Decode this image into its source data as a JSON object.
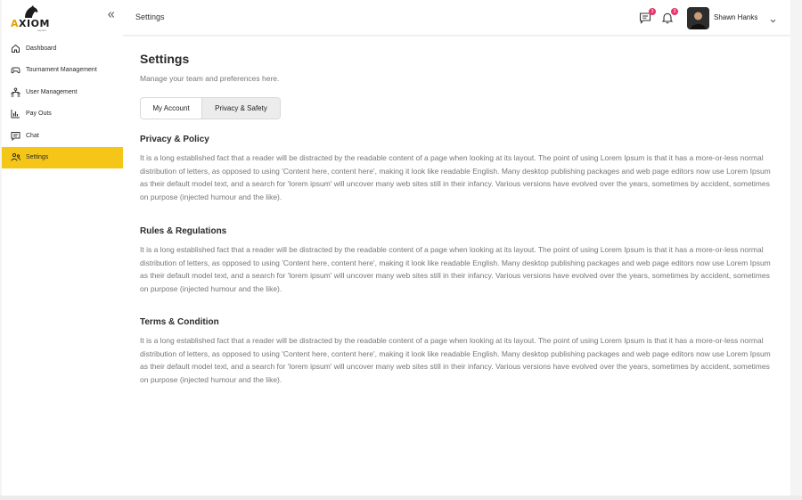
{
  "brand": {
    "name_prefix": "A",
    "name_rest": "XIOM",
    "tagline": "esports"
  },
  "sidebar": {
    "items": [
      {
        "label": "Dashboard",
        "icon": "home-icon",
        "active": false
      },
      {
        "label": "Tournament Management",
        "icon": "gamepad-icon",
        "active": false
      },
      {
        "label": "User Management",
        "icon": "users-org-icon",
        "active": false
      },
      {
        "label": "Pay Outs",
        "icon": "bar-chart-icon",
        "active": false
      },
      {
        "label": "Chat",
        "icon": "chat-icon",
        "active": false
      },
      {
        "label": "Settings",
        "icon": "people-gear-icon",
        "active": true
      }
    ]
  },
  "header": {
    "title": "Settings",
    "messages_badge": "3",
    "notifications_badge": "3",
    "user_name": "Shawn Hanks"
  },
  "main": {
    "title": "Settings",
    "subtitle": "Manage your team and preferences here.",
    "tabs": [
      {
        "label": "My Account",
        "active": false
      },
      {
        "label": "Privacy & Safety",
        "active": true
      }
    ],
    "sections": [
      {
        "title": "Privacy & Policy",
        "body": "It is a long established fact that a reader will be distracted by the readable content of a page when looking at its layout. The point of using Lorem Ipsum is that it has a more-or-less normal distribution of letters, as opposed to using 'Content here, content here', making it look like readable English. Many desktop publishing packages and web page editors now use Lorem Ipsum as their default model text, and a search for 'lorem ipsum' will uncover many web sites still in their infancy. Various versions have evolved over the years, sometimes by accident, sometimes on purpose (injected humour and the like)."
      },
      {
        "title": "Rules & Regulations",
        "body": "It is a long established fact that a reader will be distracted by the readable content of a page when looking at its layout. The point of using Lorem Ipsum is that it has a more-or-less normal distribution of letters, as opposed to using 'Content here, content here', making it look like readable English. Many desktop publishing packages and web page editors now use Lorem Ipsum as their default model text, and a search for 'lorem ipsum' will uncover many web sites still in their infancy. Various versions have evolved over the years, sometimes by accident, sometimes on purpose (injected humour and the like)."
      },
      {
        "title": "Terms & Condition",
        "body": "It is a long established fact that a reader will be distracted by the readable content of a page when looking at its layout. The point of using Lorem Ipsum is that it has a more-or-less normal distribution of letters, as opposed to using 'Content here, content here', making it look like readable English. Many desktop publishing packages and web page editors now use Lorem Ipsum as their default model text, and a search for 'lorem ipsum' will uncover many web sites still in their infancy. Various versions have evolved over the years, sometimes by accident, sometimes on purpose (injected humour and the like)."
      }
    ]
  },
  "colors": {
    "accent": "#f5c518",
    "badge": "#e8336b",
    "muted_text": "#777777"
  }
}
